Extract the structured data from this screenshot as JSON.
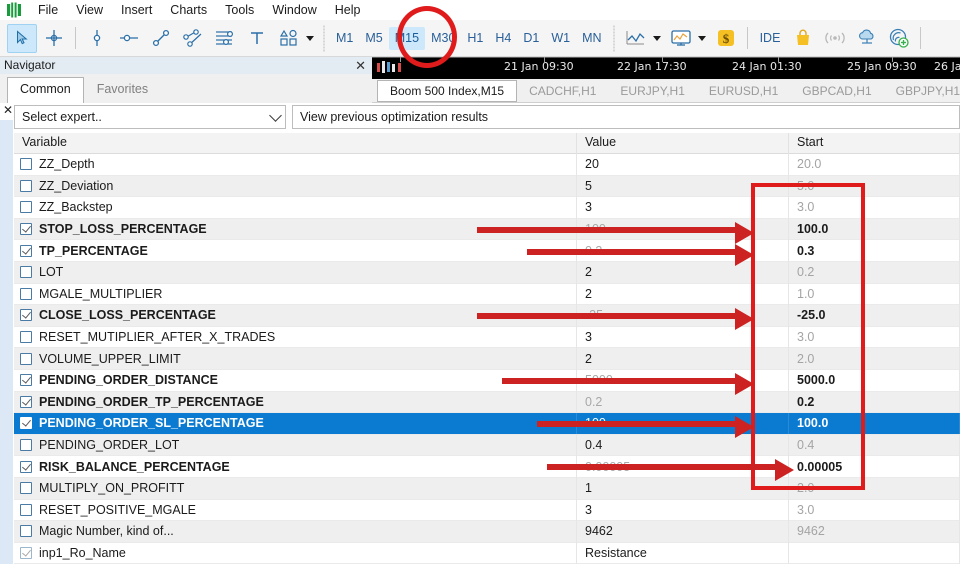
{
  "menu": {
    "logo_icon": "metatrader-logo-icon",
    "items": [
      "File",
      "View",
      "Insert",
      "Charts",
      "Tools",
      "Window",
      "Help"
    ]
  },
  "toolbar": {
    "tools": [
      {
        "name": "cursor-icon",
        "selected": true
      },
      {
        "name": "crosshair-icon",
        "selected": false
      },
      {
        "name": "bar-chart-icon",
        "selected": false
      },
      {
        "name": "horizontal-line-icon",
        "selected": false
      },
      {
        "name": "trendline-icon",
        "selected": false
      },
      {
        "name": "channel-icon",
        "selected": false
      },
      {
        "name": "fibonacci-icon",
        "selected": false
      },
      {
        "name": "text-icon",
        "selected": false
      },
      {
        "name": "shapes-icon",
        "selected": false
      }
    ],
    "timeframes": [
      "M1",
      "M5",
      "M15",
      "M30",
      "H1",
      "H4",
      "D1",
      "W1",
      "MN"
    ],
    "active_timeframe": "M15",
    "chart_type_icon": "line-chart-icon",
    "template_icon": "chart-template-icon",
    "currency_icon": "dollar-icon",
    "ide_label": "IDE",
    "market_icon": "shopping-bag-icon",
    "signals_icon": "signals-icon",
    "vps_icon": "cloud-vps-icon",
    "connect_icon": "add-connection-icon"
  },
  "navigator": {
    "title": "Navigator",
    "close_icon": "close-icon",
    "tabs": [
      {
        "label": "Common",
        "active": true
      },
      {
        "label": "Favorites",
        "active": false
      }
    ]
  },
  "chart_axis": {
    "labels": [
      "21 Jan 09:30",
      "22 Jan 17:30",
      "24 Jan 01:30",
      "25 Jan 09:30",
      "26 Jan"
    ]
  },
  "chart_tabs": {
    "items": [
      {
        "label": "Boom 500 Index,M15",
        "active": true
      },
      {
        "label": "CADCHF,H1",
        "active": false
      },
      {
        "label": "EURJPY,H1",
        "active": false
      },
      {
        "label": "EURUSD,H1",
        "active": false
      },
      {
        "label": "GBPCAD,H1",
        "active": false
      },
      {
        "label": "GBPJPY,H1",
        "active": false
      }
    ]
  },
  "tester": {
    "close_icon": "close-icon",
    "expert_select": {
      "value": "Select expert..",
      "chevron_icon": "chevron-down-icon"
    },
    "view_results_label": "View previous optimization results"
  },
  "table": {
    "headers": [
      "Variable",
      "Value",
      "Start"
    ],
    "rows": [
      {
        "checked": false,
        "bold": false,
        "variable": "ZZ_Depth",
        "value": "20",
        "start": "20.0",
        "start_bold": false,
        "value_faded": false,
        "selected": false
      },
      {
        "checked": false,
        "bold": false,
        "variable": "ZZ_Deviation",
        "value": "5",
        "start": "5.0",
        "start_bold": false,
        "value_faded": false,
        "selected": false
      },
      {
        "checked": false,
        "bold": false,
        "variable": "ZZ_Backstep",
        "value": "3",
        "start": "3.0",
        "start_bold": false,
        "value_faded": false,
        "selected": false
      },
      {
        "checked": true,
        "bold": true,
        "variable": "STOP_LOSS_PERCENTAGE",
        "value": "100",
        "start": "100.0",
        "start_bold": true,
        "value_faded": true,
        "selected": false
      },
      {
        "checked": true,
        "bold": true,
        "variable": "TP_PERCENTAGE",
        "value": "0.3",
        "start": "0.3",
        "start_bold": true,
        "value_faded": true,
        "selected": false
      },
      {
        "checked": false,
        "bold": false,
        "variable": "LOT",
        "value": "2",
        "start": "0.2",
        "start_bold": false,
        "value_faded": false,
        "selected": false
      },
      {
        "checked": false,
        "bold": false,
        "variable": "MGALE_MULTIPLIER",
        "value": "2",
        "start": "1.0",
        "start_bold": false,
        "value_faded": false,
        "selected": false
      },
      {
        "checked": true,
        "bold": true,
        "variable": "CLOSE_LOSS_PERCENTAGE",
        "value": "-25",
        "start": "-25.0",
        "start_bold": true,
        "value_faded": true,
        "selected": false
      },
      {
        "checked": false,
        "bold": false,
        "variable": "RESET_MUTIPLIER_AFTER_X_TRADES",
        "value": "3",
        "start": "3.0",
        "start_bold": false,
        "value_faded": false,
        "selected": false
      },
      {
        "checked": false,
        "bold": false,
        "variable": "VOLUME_UPPER_LIMIT",
        "value": "2",
        "start": "2.0",
        "start_bold": false,
        "value_faded": false,
        "selected": false
      },
      {
        "checked": true,
        "bold": true,
        "variable": "PENDING_ORDER_DISTANCE",
        "value": "5000",
        "start": "5000.0",
        "start_bold": true,
        "value_faded": true,
        "selected": false
      },
      {
        "checked": true,
        "bold": true,
        "variable": "PENDING_ORDER_TP_PERCENTAGE",
        "value": "0.2",
        "start": "0.2",
        "start_bold": true,
        "value_faded": true,
        "selected": false
      },
      {
        "checked": true,
        "bold": true,
        "variable": "PENDING_ORDER_SL_PERCENTAGE",
        "value": "100",
        "start": "100.0",
        "start_bold": true,
        "value_faded": false,
        "selected": true
      },
      {
        "checked": false,
        "bold": false,
        "variable": "PENDING_ORDER_LOT",
        "value": "0.4",
        "start": "0.4",
        "start_bold": false,
        "value_faded": false,
        "selected": false
      },
      {
        "checked": true,
        "bold": true,
        "variable": "RISK_BALANCE_PERCENTAGE",
        "value": "0.00005",
        "start": "0.00005",
        "start_bold": true,
        "value_faded": true,
        "selected": false
      },
      {
        "checked": false,
        "bold": false,
        "variable": "MULTIPLY_ON_PROFITT",
        "value": "1",
        "start": "2.0",
        "start_bold": false,
        "value_faded": false,
        "selected": false
      },
      {
        "checked": false,
        "bold": false,
        "variable": "RESET_POSITIVE_MGALE",
        "value": "3",
        "start": "3.0",
        "start_bold": false,
        "value_faded": false,
        "selected": false
      },
      {
        "checked": false,
        "bold": false,
        "variable": "Magic Number, kind of...",
        "value": "9462",
        "start": "9462",
        "start_bold": false,
        "value_faded": false,
        "selected": false
      },
      {
        "checked": true,
        "bold": false,
        "variable": "inp1_Ro_Name",
        "value": "Resistance",
        "start": "",
        "start_bold": false,
        "value_faded": false,
        "selected": false,
        "dim_check": true
      }
    ]
  },
  "annotations": {
    "color": "#cc2222",
    "circle_target": "M15",
    "box_target": "start-column-highlight",
    "arrow_targets": [
      "STOP_LOSS_PERCENTAGE",
      "TP_PERCENTAGE",
      "CLOSE_LOSS_PERCENTAGE",
      "PENDING_ORDER_DISTANCE",
      "PENDING_ORDER_SL_PERCENTAGE",
      "RISK_BALANCE_PERCENTAGE"
    ]
  }
}
